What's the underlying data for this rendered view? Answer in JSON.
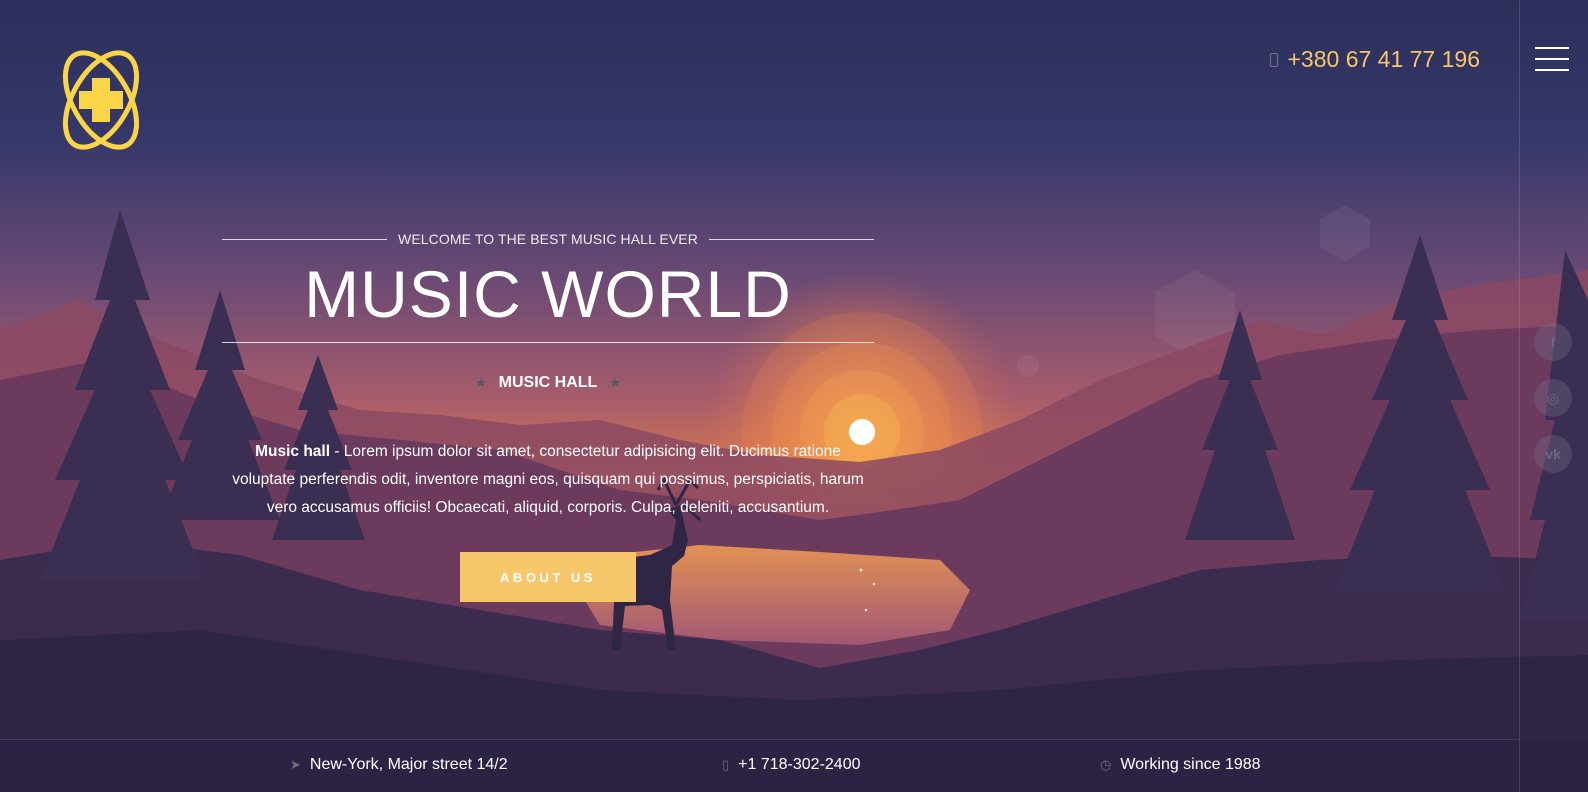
{
  "header": {
    "phone": "+380 67 41 77 196"
  },
  "hero": {
    "welcome": "WELCOME TO THE BEST MUSIC HALL EVER",
    "title": "MUSIC WORLD",
    "subtitle": "MUSIC HALL",
    "description_bold": "Music hall",
    "description_rest": " - Lorem ipsum dolor sit amet, consectetur adipisicing elit. Ducimus ratione voluptate perferendis odit, inventore magni eos, quisquam qui possimus, perspiciatis, harum vero accusamus officiis! Obcaecati, aliquid, corporis. Culpa, deleniti, accusantium.",
    "button": "ABOUT US"
  },
  "social": [
    {
      "icon": "facebook-icon",
      "glyph": "f"
    },
    {
      "icon": "instagram-icon",
      "glyph": "◎"
    },
    {
      "icon": "vk-icon",
      "glyph": "vk"
    }
  ],
  "footer": {
    "address": "New-York, Major street 14/2",
    "phone": "+1 718-302-2400",
    "working": "Working since 1988"
  },
  "colors": {
    "accent": "#f7c86b",
    "logo": "#f9d547",
    "sky_top": "#2d3260",
    "sunset": "#e2894a"
  }
}
